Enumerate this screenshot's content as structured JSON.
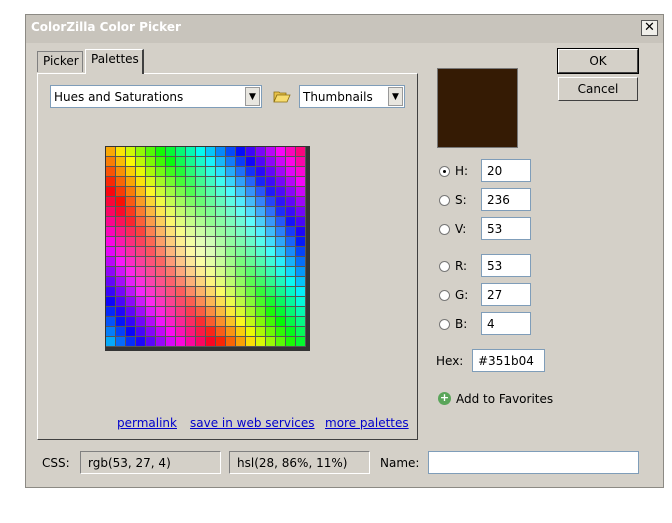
{
  "window": {
    "title": "ColorZilla Color Picker",
    "close_glyph": "✕"
  },
  "tabs": [
    {
      "label": "Picker"
    },
    {
      "label": "Palettes"
    }
  ],
  "palette": {
    "selected": "Hues and Saturations",
    "view": "Thumbnails"
  },
  "links": [
    {
      "label": "permalink"
    },
    {
      "label": "save in web services"
    },
    {
      "label": "more palettes"
    }
  ],
  "color": {
    "swatch": "#351b04",
    "H": "20",
    "S": "236",
    "V": "53",
    "R": "53",
    "G": "27",
    "B": "4",
    "hex": "#351b04",
    "selected_channel": "H"
  },
  "labels": {
    "H": "H:",
    "S": "S:",
    "V": "V:",
    "R": "R:",
    "G": "G:",
    "B": "B:",
    "hex": "Hex:",
    "css": "CSS:",
    "name": "Name:"
  },
  "buttons": {
    "ok": "OK",
    "cancel": "Cancel",
    "add_favorites": "Add to Favorites"
  },
  "css_values": {
    "rgb": "rgb(53, 27, 4)",
    "hsl": "hsl(28, 86%, 11%)"
  },
  "name_value": ""
}
